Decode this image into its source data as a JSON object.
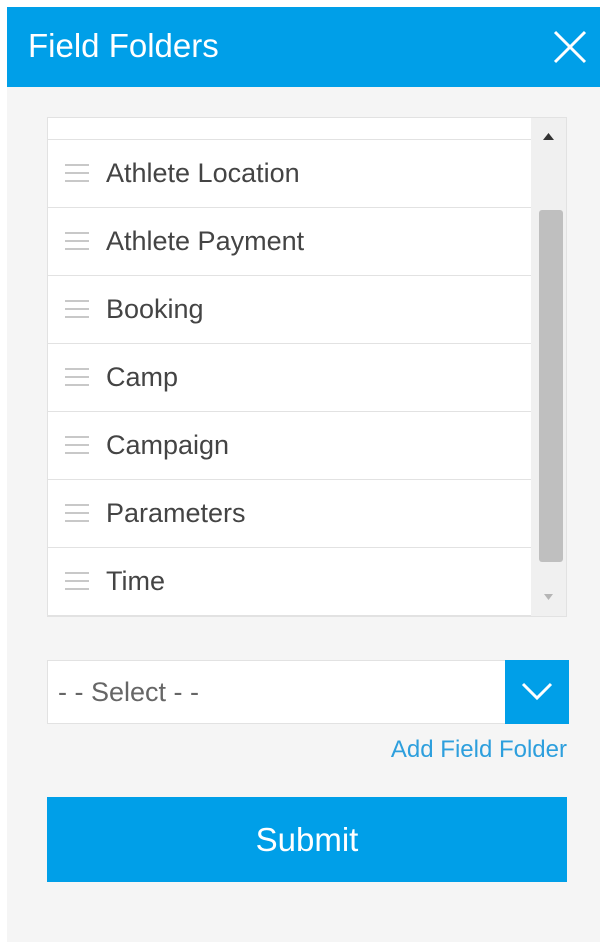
{
  "header": {
    "title": "Field Folders",
    "close_icon": "close-icon"
  },
  "folders": {
    "items": [
      {
        "label": ""
      },
      {
        "label": "Athlete Location"
      },
      {
        "label": "Athlete Payment"
      },
      {
        "label": "Booking"
      },
      {
        "label": "Camp"
      },
      {
        "label": "Campaign"
      },
      {
        "label": "Parameters"
      },
      {
        "label": "Time"
      }
    ],
    "scroll_fraction": 0.72
  },
  "select": {
    "value": "- - Select - -"
  },
  "add_folder_link": "Add Field Folder",
  "submit_label": "Submit",
  "colors": {
    "accent": "#009fe8",
    "link": "#2d9fdd",
    "text": "#444444"
  }
}
